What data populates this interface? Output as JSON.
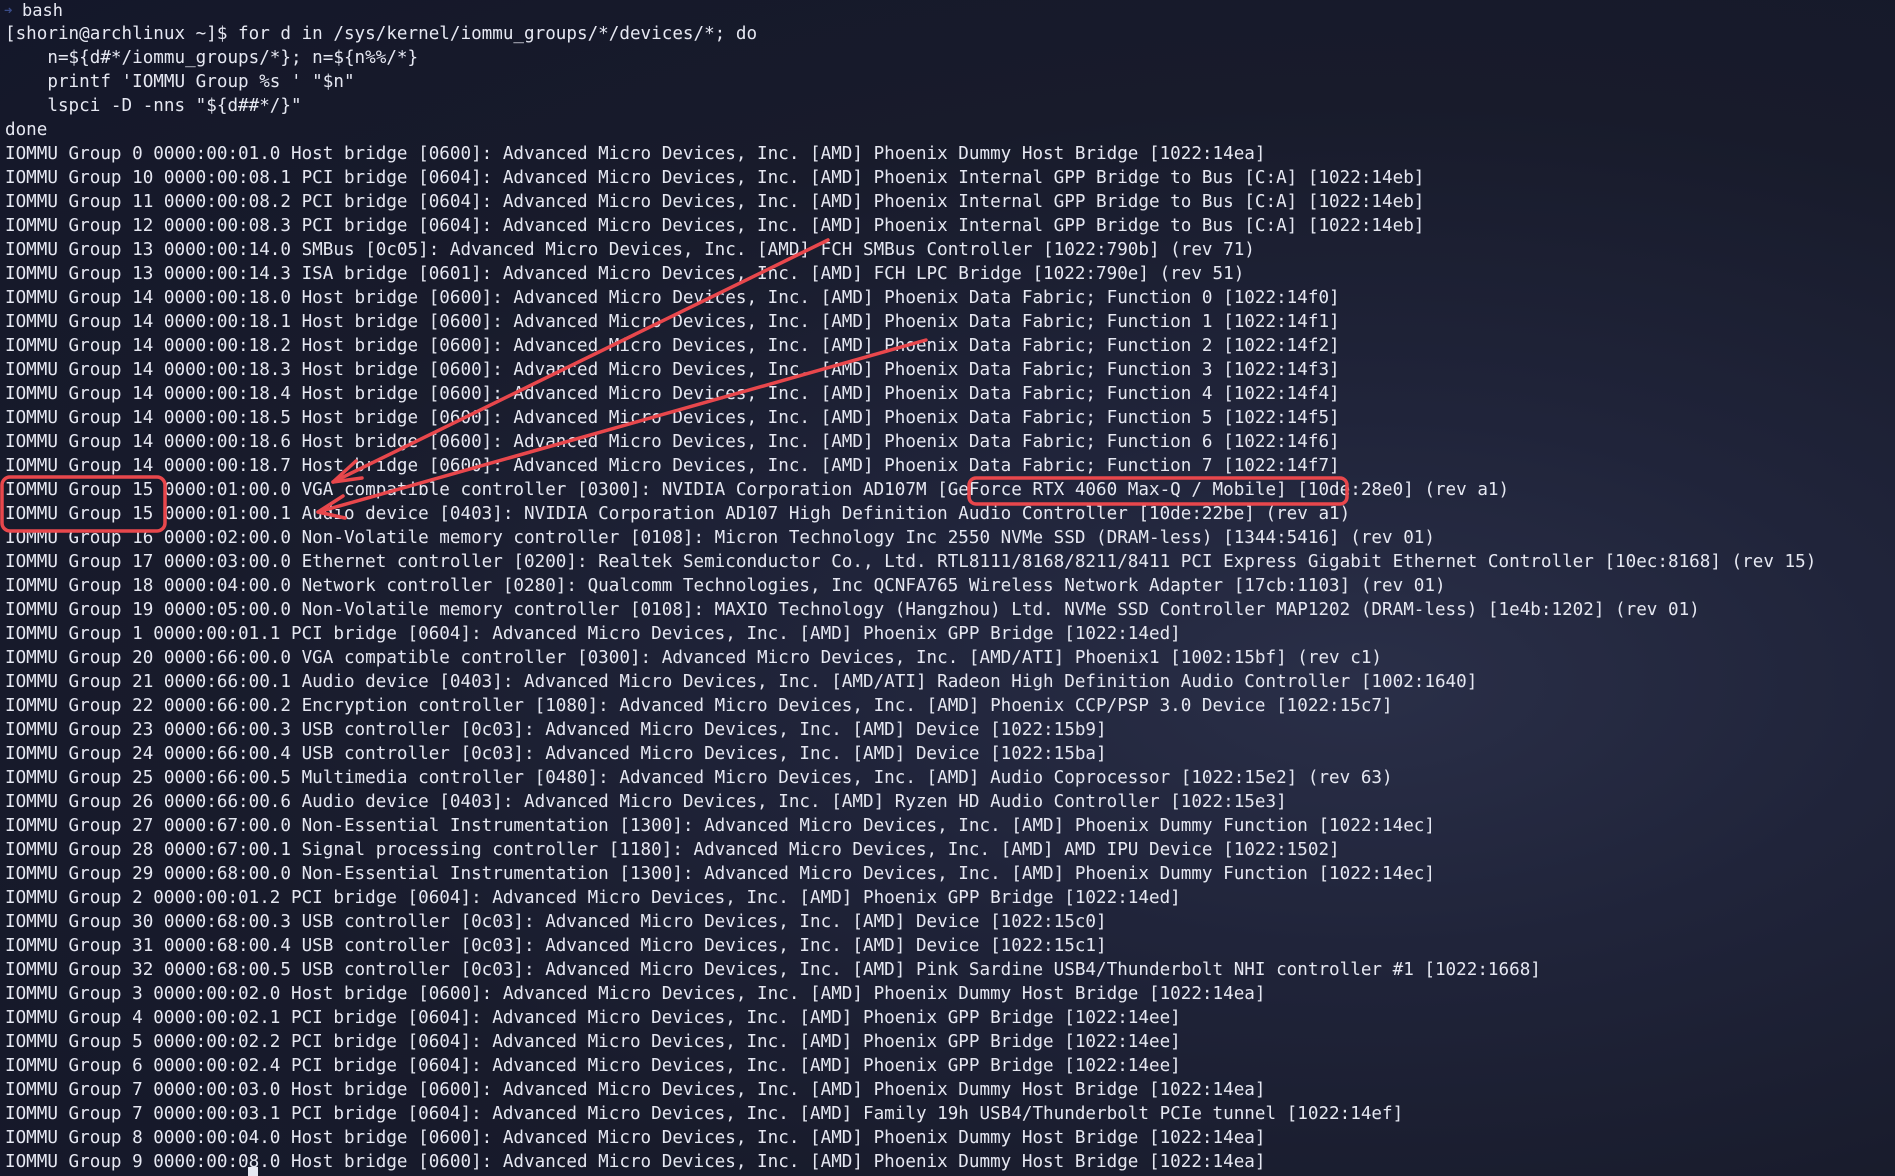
{
  "window": {
    "title": "bash"
  },
  "terminal": {
    "lines": [
      "[shorin@archlinux ~]$ for d in /sys/kernel/iommu_groups/*/devices/*; do",
      "    n=${d#*/iommu_groups/*}; n=${n%%/*}",
      "    printf 'IOMMU Group %s ' \"$n\"",
      "    lspci -D -nns \"${d##*/}\"",
      "done",
      "IOMMU Group 0 0000:00:01.0 Host bridge [0600]: Advanced Micro Devices, Inc. [AMD] Phoenix Dummy Host Bridge [1022:14ea]",
      "IOMMU Group 10 0000:00:08.1 PCI bridge [0604]: Advanced Micro Devices, Inc. [AMD] Phoenix Internal GPP Bridge to Bus [C:A] [1022:14eb]",
      "IOMMU Group 11 0000:00:08.2 PCI bridge [0604]: Advanced Micro Devices, Inc. [AMD] Phoenix Internal GPP Bridge to Bus [C:A] [1022:14eb]",
      "IOMMU Group 12 0000:00:08.3 PCI bridge [0604]: Advanced Micro Devices, Inc. [AMD] Phoenix Internal GPP Bridge to Bus [C:A] [1022:14eb]",
      "IOMMU Group 13 0000:00:14.0 SMBus [0c05]: Advanced Micro Devices, Inc. [AMD] FCH SMBus Controller [1022:790b] (rev 71)",
      "IOMMU Group 13 0000:00:14.3 ISA bridge [0601]: Advanced Micro Devices, Inc. [AMD] FCH LPC Bridge [1022:790e] (rev 51)",
      "IOMMU Group 14 0000:00:18.0 Host bridge [0600]: Advanced Micro Devices, Inc. [AMD] Phoenix Data Fabric; Function 0 [1022:14f0]",
      "IOMMU Group 14 0000:00:18.1 Host bridge [0600]: Advanced Micro Devices, Inc. [AMD] Phoenix Data Fabric; Function 1 [1022:14f1]",
      "IOMMU Group 14 0000:00:18.2 Host bridge [0600]: Advanced Micro Devices, Inc. [AMD] Phoenix Data Fabric; Function 2 [1022:14f2]",
      "IOMMU Group 14 0000:00:18.3 Host bridge [0600]: Advanced Micro Devices, Inc. [AMD] Phoenix Data Fabric; Function 3 [1022:14f3]",
      "IOMMU Group 14 0000:00:18.4 Host bridge [0600]: Advanced Micro Devices, Inc. [AMD] Phoenix Data Fabric; Function 4 [1022:14f4]",
      "IOMMU Group 14 0000:00:18.5 Host bridge [0600]: Advanced Micro Devices, Inc. [AMD] Phoenix Data Fabric; Function 5 [1022:14f5]",
      "IOMMU Group 14 0000:00:18.6 Host bridge [0600]: Advanced Micro Devices, Inc. [AMD] Phoenix Data Fabric; Function 6 [1022:14f6]",
      "IOMMU Group 14 0000:00:18.7 Host bridge [0600]: Advanced Micro Devices, Inc. [AMD] Phoenix Data Fabric; Function 7 [1022:14f7]",
      "IOMMU Group 15 0000:01:00.0 VGA compatible controller [0300]: NVIDIA Corporation AD107M [GeForce RTX 4060 Max-Q / Mobile] [10de:28e0] (rev a1)",
      "IOMMU Group 15 0000:01:00.1 Audio device [0403]: NVIDIA Corporation AD107 High Definition Audio Controller [10de:22be] (rev a1)",
      "IOMMU Group 16 0000:02:00.0 Non-Volatile memory controller [0108]: Micron Technology Inc 2550 NVMe SSD (DRAM-less) [1344:5416] (rev 01)",
      "IOMMU Group 17 0000:03:00.0 Ethernet controller [0200]: Realtek Semiconductor Co., Ltd. RTL8111/8168/8211/8411 PCI Express Gigabit Ethernet Controller [10ec:8168] (rev 15)",
      "IOMMU Group 18 0000:04:00.0 Network controller [0280]: Qualcomm Technologies, Inc QCNFA765 Wireless Network Adapter [17cb:1103] (rev 01)",
      "IOMMU Group 19 0000:05:00.0 Non-Volatile memory controller [0108]: MAXIO Technology (Hangzhou) Ltd. NVMe SSD Controller MAP1202 (DRAM-less) [1e4b:1202] (rev 01)",
      "IOMMU Group 1 0000:00:01.1 PCI bridge [0604]: Advanced Micro Devices, Inc. [AMD] Phoenix GPP Bridge [1022:14ed]",
      "IOMMU Group 20 0000:66:00.0 VGA compatible controller [0300]: Advanced Micro Devices, Inc. [AMD/ATI] Phoenix1 [1002:15bf] (rev c1)",
      "IOMMU Group 21 0000:66:00.1 Audio device [0403]: Advanced Micro Devices, Inc. [AMD/ATI] Radeon High Definition Audio Controller [1002:1640]",
      "IOMMU Group 22 0000:66:00.2 Encryption controller [1080]: Advanced Micro Devices, Inc. [AMD] Phoenix CCP/PSP 3.0 Device [1022:15c7]",
      "IOMMU Group 23 0000:66:00.3 USB controller [0c03]: Advanced Micro Devices, Inc. [AMD] Device [1022:15b9]",
      "IOMMU Group 24 0000:66:00.4 USB controller [0c03]: Advanced Micro Devices, Inc. [AMD] Device [1022:15ba]",
      "IOMMU Group 25 0000:66:00.5 Multimedia controller [0480]: Advanced Micro Devices, Inc. [AMD] Audio Coprocessor [1022:15e2] (rev 63)",
      "IOMMU Group 26 0000:66:00.6 Audio device [0403]: Advanced Micro Devices, Inc. [AMD] Ryzen HD Audio Controller [1022:15e3]",
      "IOMMU Group 27 0000:67:00.0 Non-Essential Instrumentation [1300]: Advanced Micro Devices, Inc. [AMD] Phoenix Dummy Function [1022:14ec]",
      "IOMMU Group 28 0000:67:00.1 Signal processing controller [1180]: Advanced Micro Devices, Inc. [AMD] AMD IPU Device [1022:1502]",
      "IOMMU Group 29 0000:68:00.0 Non-Essential Instrumentation [1300]: Advanced Micro Devices, Inc. [AMD] Phoenix Dummy Function [1022:14ec]",
      "IOMMU Group 2 0000:00:01.2 PCI bridge [0604]: Advanced Micro Devices, Inc. [AMD] Phoenix GPP Bridge [1022:14ed]",
      "IOMMU Group 30 0000:68:00.3 USB controller [0c03]: Advanced Micro Devices, Inc. [AMD] Device [1022:15c0]",
      "IOMMU Group 31 0000:68:00.4 USB controller [0c03]: Advanced Micro Devices, Inc. [AMD] Device [1022:15c1]",
      "IOMMU Group 32 0000:68:00.5 USB controller [0c03]: Advanced Micro Devices, Inc. [AMD] Pink Sardine USB4/Thunderbolt NHI controller #1 [1022:1668]",
      "IOMMU Group 3 0000:00:02.0 Host bridge [0600]: Advanced Micro Devices, Inc. [AMD] Phoenix Dummy Host Bridge [1022:14ea]",
      "IOMMU Group 4 0000:00:02.1 PCI bridge [0604]: Advanced Micro Devices, Inc. [AMD] Phoenix GPP Bridge [1022:14ee]",
      "IOMMU Group 5 0000:00:02.2 PCI bridge [0604]: Advanced Micro Devices, Inc. [AMD] Phoenix GPP Bridge [1022:14ee]",
      "IOMMU Group 6 0000:00:02.4 PCI bridge [0604]: Advanced Micro Devices, Inc. [AMD] Phoenix GPP Bridge [1022:14ee]",
      "IOMMU Group 7 0000:00:03.0 Host bridge [0600]: Advanced Micro Devices, Inc. [AMD] Phoenix Dummy Host Bridge [1022:14ea]",
      "IOMMU Group 7 0000:00:03.1 PCI bridge [0604]: Advanced Micro Devices, Inc. [AMD] Family 19h USB4/Thunderbolt PCIe tunnel [1022:14ef]",
      "IOMMU Group 8 0000:00:04.0 Host bridge [0600]: Advanced Micro Devices, Inc. [AMD] Phoenix Dummy Host Bridge [1022:14ea]",
      "IOMMU Group 9 0000:00:08.0 Host bridge [0600]: Advanced Micro Devices, Inc. [AMD] Phoenix Dummy Host Bridge [1022:14ea]"
    ]
  },
  "colors": {
    "text": "#e6e8f2",
    "annotation": "#e8474c",
    "background": "#181b2b"
  }
}
